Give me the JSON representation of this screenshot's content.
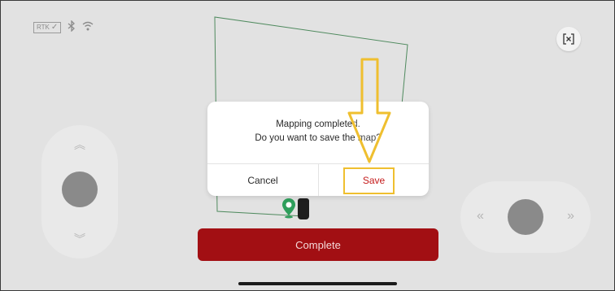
{
  "status_bar": {
    "rtk_label": "RTK",
    "icons": [
      "check-icon",
      "bluetooth-icon",
      "wifi-icon"
    ]
  },
  "exit_button": {
    "icon": "exit-fullscreen-icon"
  },
  "joystick_left": {
    "icons": [
      "chevron-double-up-icon",
      "chevron-double-down-icon"
    ]
  },
  "joystick_right": {
    "icons": [
      "chevron-double-left-icon",
      "chevron-double-right-icon"
    ]
  },
  "dialog": {
    "line1": "Mapping completed.",
    "line2": "Do you want to save the map?",
    "cancel_label": "Cancel",
    "save_label": "Save"
  },
  "complete_button": {
    "label": "Complete"
  },
  "colors": {
    "brand_red": "#a20f13",
    "save_text": "#c41a1a",
    "highlight_yellow": "#efbf2f",
    "map_outline": "#4f8a5e"
  }
}
